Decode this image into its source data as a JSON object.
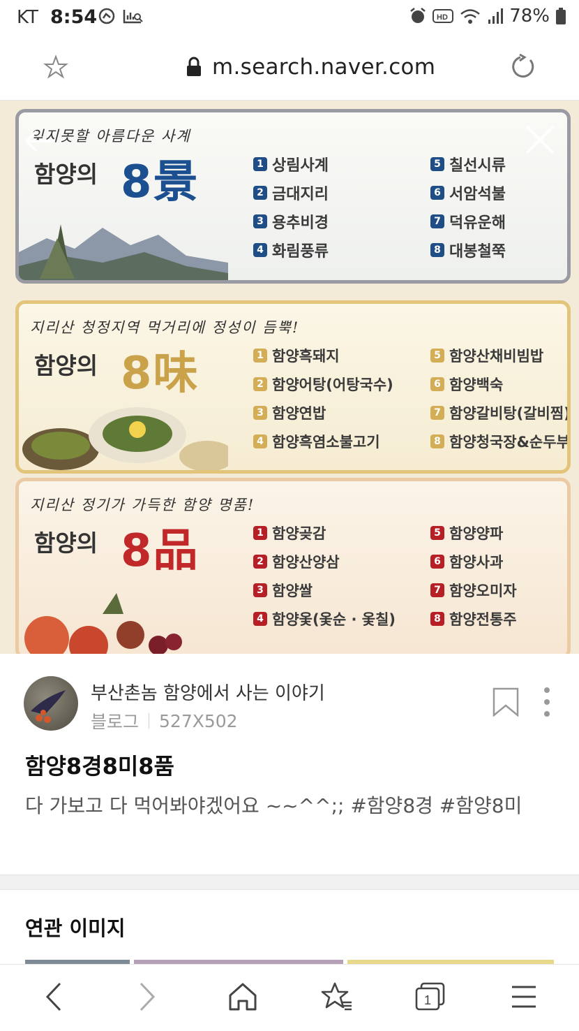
{
  "status_bar": {
    "carrier": "KT",
    "time": "8:54",
    "battery": "78%"
  },
  "address_bar": {
    "url": "m.search.naver.com"
  },
  "image": {
    "panels": [
      {
        "tagline": "잊지못할 아름다운 사계",
        "heading": "함양의",
        "big": "8景",
        "left_items": [
          {
            "n": "1",
            "label": "상림사계"
          },
          {
            "n": "2",
            "label": "금대지리"
          },
          {
            "n": "3",
            "label": "용추비경"
          },
          {
            "n": "4",
            "label": "화림풍류"
          }
        ],
        "right_items": [
          {
            "n": "5",
            "label": "칠선시류"
          },
          {
            "n": "6",
            "label": "서암석불"
          },
          {
            "n": "7",
            "label": "덕유운해"
          },
          {
            "n": "8",
            "label": "대봉철쭉"
          }
        ]
      },
      {
        "tagline": "지리산 청정지역 먹거리에 정성이 듬뿍!",
        "heading": "함양의",
        "big": "8味",
        "left_items": [
          {
            "n": "1",
            "label": "함양흑돼지"
          },
          {
            "n": "2",
            "label": "함양어탕(어탕국수)"
          },
          {
            "n": "3",
            "label": "함양연밥"
          },
          {
            "n": "4",
            "label": "함양흑염소불고기"
          }
        ],
        "right_items": [
          {
            "n": "5",
            "label": "함양산채비빔밥"
          },
          {
            "n": "6",
            "label": "함양백숙"
          },
          {
            "n": "7",
            "label": "함양갈비탕(갈비찜)"
          },
          {
            "n": "8",
            "label": "함양청국장&순두부"
          }
        ]
      },
      {
        "tagline": "지리산 정기가 가득한 함양 명품!",
        "heading": "함양의",
        "big": "8品",
        "left_items": [
          {
            "n": "1",
            "label": "함양곶감"
          },
          {
            "n": "2",
            "label": "함양산양삼"
          },
          {
            "n": "3",
            "label": "함양쌀"
          },
          {
            "n": "4",
            "label": "함양옻(옻순 · 옻칠)"
          }
        ],
        "right_items": [
          {
            "n": "5",
            "label": "함양양파"
          },
          {
            "n": "6",
            "label": "함양사과"
          },
          {
            "n": "7",
            "label": "함양오미자"
          },
          {
            "n": "8",
            "label": "함양전통주"
          }
        ]
      }
    ]
  },
  "info": {
    "blog_name": "부산촌놈 함양에서 사는 이야기",
    "source": "블로그",
    "dimensions": "527X502",
    "title": "함양8경8미8품",
    "description": "다 가보고 다 먹어봐야겠어요 ~~^^;; #함양8경 #함양8미"
  },
  "related": {
    "label": "연관 이미지"
  },
  "colors": {
    "accent_blue": "#1c4f8f",
    "accent_gold": "#c9a24a",
    "accent_red": "#c0282a"
  },
  "icons": [
    "star-icon",
    "lock-icon",
    "reload-icon",
    "back-arrow-icon",
    "close-icon",
    "bookmark-icon",
    "more-icon",
    "back-icon",
    "forward-icon",
    "home-icon",
    "bookmarks-icon",
    "tabs-icon",
    "menu-icon"
  ],
  "bottom_nav": {
    "tabs_count": "1"
  }
}
